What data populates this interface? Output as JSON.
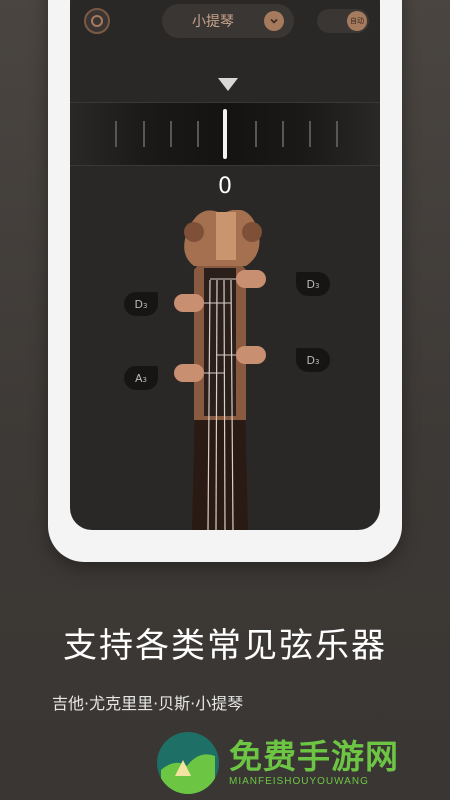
{
  "topbar": {
    "instrument": "小提琴",
    "auto_label": "自动"
  },
  "tuner": {
    "cents": "0"
  },
  "strings": {
    "left_upper": {
      "note": "D",
      "octave": "3"
    },
    "left_lower": {
      "note": "A",
      "octave": "3"
    },
    "right_upper": {
      "note": "D",
      "octave": "3"
    },
    "right_lower": {
      "note": "D",
      "octave": "3"
    }
  },
  "promo": {
    "headline": "支持各类常见弦乐器",
    "subline": "吉他·尤克里里·贝斯·小提琴"
  },
  "brand": {
    "name": "免费手游网",
    "sub": "MIANFEISHOUYOUWANG"
  },
  "colors": {
    "accent": "#a67a5d",
    "brand_green": "#6cc644"
  }
}
